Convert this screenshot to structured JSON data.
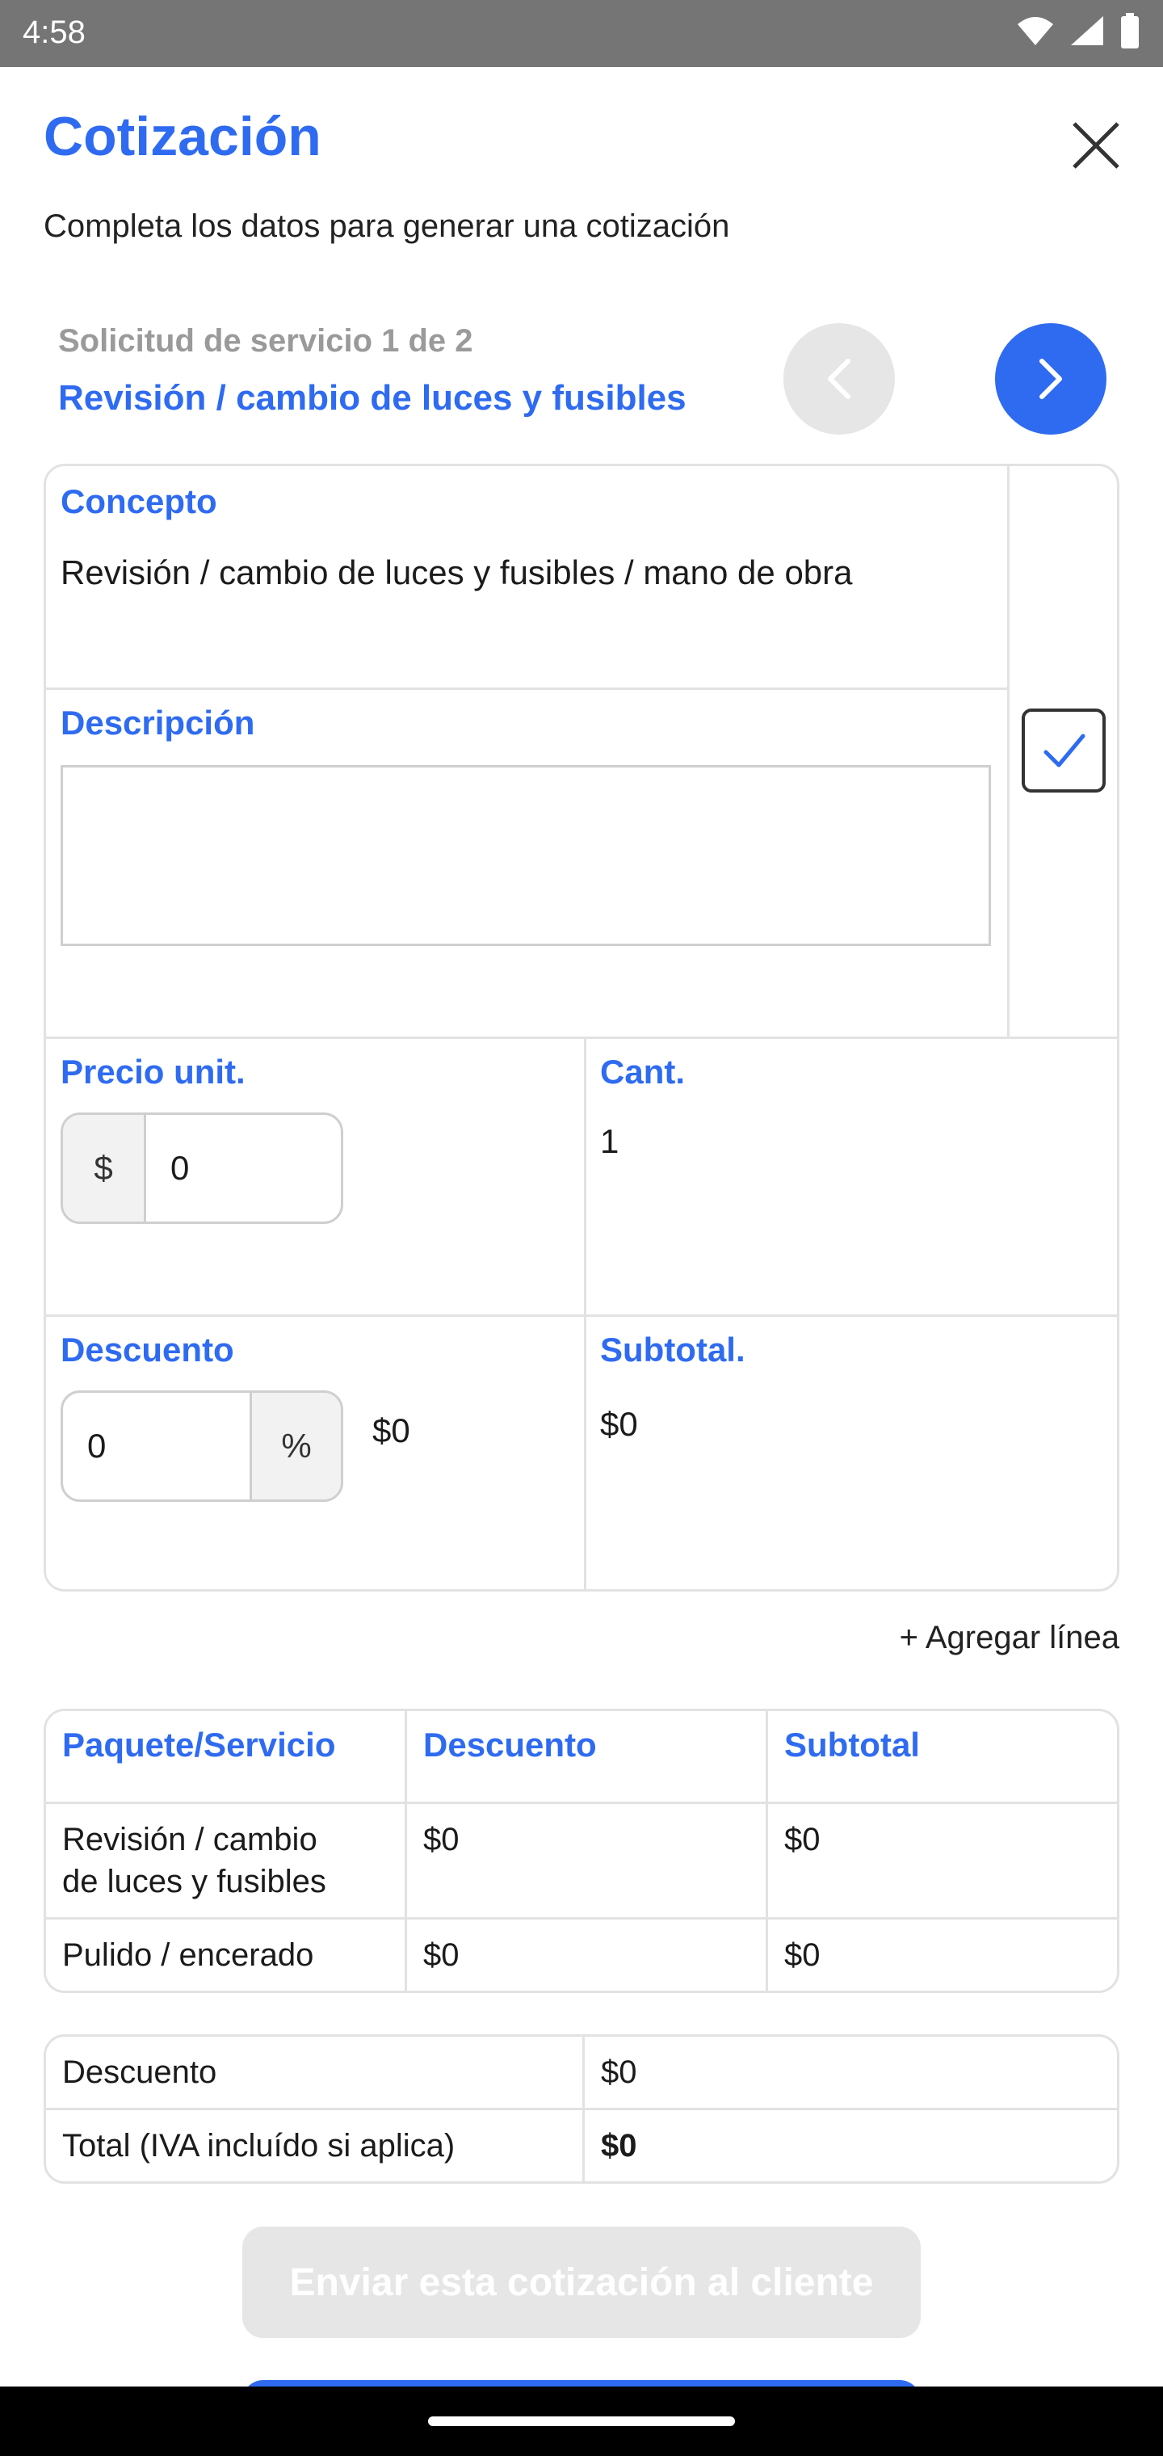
{
  "status_bar": {
    "time": "4:58"
  },
  "header": {
    "title": "Cotización",
    "subtitle": "Completa los datos para generar una cotización"
  },
  "request": {
    "counter": "Solicitud de servicio 1 de 2",
    "service": "Revisión / cambio de luces y fusibles"
  },
  "line_form": {
    "concept_label": "Concepto",
    "concept_value": "Revisión / cambio de luces y fusibles / mano de obra",
    "description_label": "Descripción",
    "description_value": "",
    "price_label": "Precio unit.",
    "price_currency": "$",
    "price_value": "0",
    "qty_label": "Cant.",
    "qty_value": "1",
    "discount_label": "Descuento",
    "discount_value": "0",
    "discount_unit": "%",
    "discount_amount": "$0",
    "subtotal_label": "Subtotal.",
    "subtotal_value": "$0",
    "checkbox_checked": true
  },
  "add_line": "+ Agregar línea",
  "services_table": {
    "headers": [
      "Paquete/Servicio",
      "Descuento",
      "Subtotal"
    ],
    "rows": [
      [
        "Revisión / cambio de luces y fusibles",
        "$0",
        "$0"
      ],
      [
        "Pulido / encerado",
        "$0",
        "$0"
      ]
    ]
  },
  "totals": {
    "discount_label": "Descuento",
    "discount_value": "$0",
    "total_label": "Total (IVA incluído si aplica)",
    "total_value": "$0"
  },
  "send_button": "Enviar esta cotización al cliente",
  "colors": {
    "accent": "#2f6bf1",
    "border": "#e2e2e2",
    "disabled": "#e6e6e6"
  }
}
